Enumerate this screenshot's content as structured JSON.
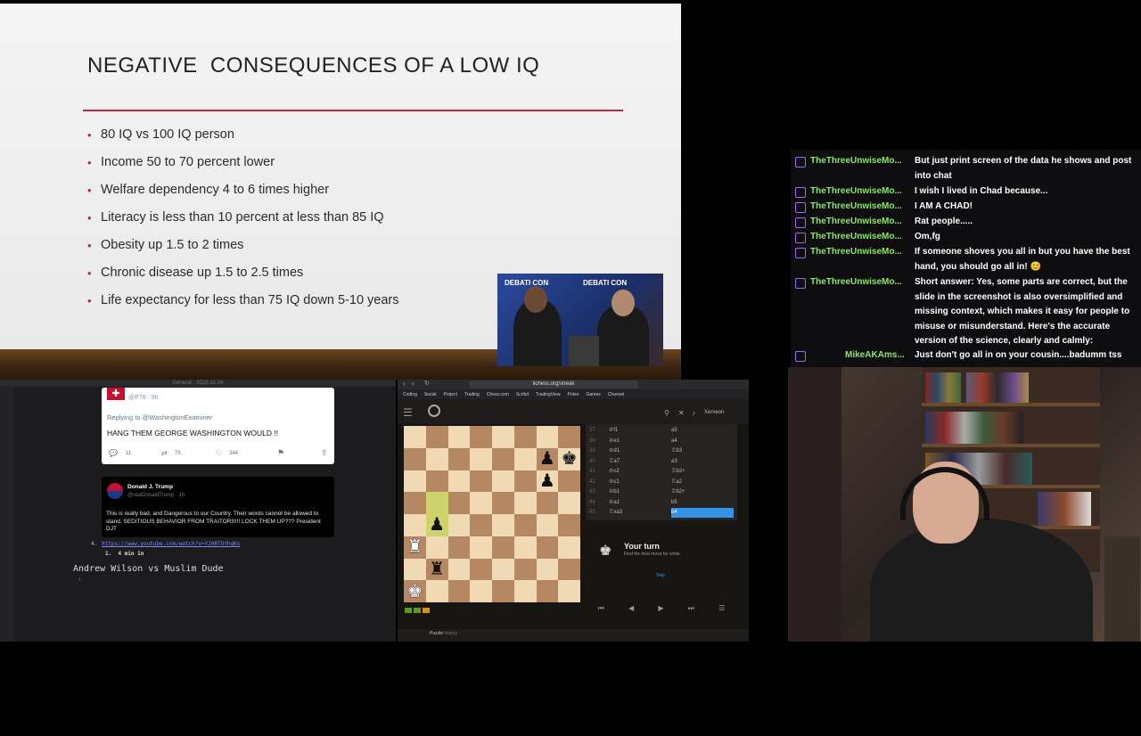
{
  "slide": {
    "title": "NEGATIVE  CONSEQUENCES OF A LOW IQ",
    "bullets": [
      "80 IQ vs 100 IQ person",
      "Income 50 to 70 percent lower",
      "Welfare dependency 4 to 6 times higher",
      "Literacy is less than 10 percent at less than 85 IQ",
      "Obesity up 1.5 to 2 times",
      "Chronic disease up 1.5 to 2.5 times",
      "Life expectancy for less than 75 IQ down 5-10 years"
    ],
    "bullet_glyph": "•",
    "accent_color": "#b2303b"
  },
  "debate_cam": {
    "banner_left": "DEBATI CON",
    "banner_right": "DEBATI CON"
  },
  "chat": {
    "messages": [
      {
        "user": "TheThreeUnwiseMo...",
        "text": "But just print screen of the data he shows and post into chat"
      },
      {
        "user": "TheThreeUnwiseMo...",
        "text": "I wish I lived in Chad because..."
      },
      {
        "user": "TheThreeUnwiseMo...",
        "text": "I AM A CHAD!"
      },
      {
        "user": "TheThreeUnwiseMo...",
        "text": "Rat people....."
      },
      {
        "user": "TheThreeUnwiseMo...",
        "text": "Om,fg"
      },
      {
        "user": "TheThreeUnwiseMo...",
        "text": "If someone shoves you all in but you have the best hand, you should go all in! 😊"
      },
      {
        "user": "TheThreeUnwiseMo...",
        "text": "Short answer: Yes, some parts are correct, but the slide in the screenshot is also oversimplified and missing context, which makes it easy for people to misuse or misunderstand. Here's the accurate version of the science, clearly and calmly:"
      },
      {
        "user": "MikeAKAms...",
        "text": "Just don't go all in on your cousin....badumm tss"
      }
    ],
    "user_color": "#8fe46a"
  },
  "terminal": {
    "header": "General · 2025-11-26",
    "tweet1": {
      "handle": "@P78 · 9h",
      "reply_to": "Replying to @WashingtonExaminer",
      "text": "HANG THEM GEORGE WASHINGTON WOULD !!",
      "replies": "11",
      "retweets": "79",
      "likes": "344"
    },
    "tweet2": {
      "name": "Donald J. Trump",
      "handle": "@realDonaldTrump · 1h",
      "text": "This is really bad, and Dangerous to our Country. Their words cannot be allowed to stand. SEDITIOUS BEHAVIOR FROM TRAITORS!!! LOCK THEM UP??? President DJT"
    },
    "list_number": "4.",
    "link": "https://www.youtube.com/watch?v=YJ0RTOYhqKs",
    "sub_item": "1.  4 min in",
    "heading": "Andrew Wilson vs Muslim Dude",
    "next_number": "1."
  },
  "browser": {
    "url": "lichess.org/streak",
    "bookmarks": [
      "Coding",
      "Social",
      "Project",
      "Trading",
      "Chess.com",
      "Scribd",
      "TradingView",
      "Poker",
      "Games",
      "Channel"
    ],
    "username": "Xerveon",
    "your_turn": "Your turn",
    "hint": "Find the best move for white.",
    "skip": "Skip",
    "bottom_tab": "Puzzle",
    "bottom_sub": "history"
  },
  "moves": [
    [
      "37",
      "♔f1",
      "a5"
    ],
    [
      "38",
      "♔e1",
      "a4"
    ],
    [
      "39",
      "♔d1",
      "♖b3"
    ],
    [
      "40",
      "♖a7",
      "a3"
    ],
    [
      "41",
      "♔c2",
      "♖b2+"
    ],
    [
      "42",
      "♔c1",
      "♖a2"
    ],
    [
      "43",
      "♔b1",
      "♖b2+"
    ],
    [
      "44",
      "♔a1",
      "b5"
    ],
    [
      "45",
      "♖xa3",
      "b4"
    ]
  ],
  "board": [
    [
      "",
      "",
      "",
      "",
      "",
      "",
      "",
      ""
    ],
    [
      "",
      "",
      "",
      "",
      "",
      "",
      "bp",
      "bk"
    ],
    [
      "",
      "",
      "",
      "",
      "",
      "",
      "bp",
      ""
    ],
    [
      "",
      "",
      "",
      "",
      "",
      "",
      "",
      ""
    ],
    [
      "",
      "hl-bp",
      "",
      "",
      "",
      "",
      "",
      ""
    ],
    [
      "wr",
      "",
      "",
      "",
      "",
      "",
      "",
      ""
    ],
    [
      "",
      "br",
      "",
      "",
      "",
      "",
      "",
      ""
    ],
    [
      "wk",
      "",
      "",
      "",
      "",
      "",
      "",
      ""
    ]
  ]
}
